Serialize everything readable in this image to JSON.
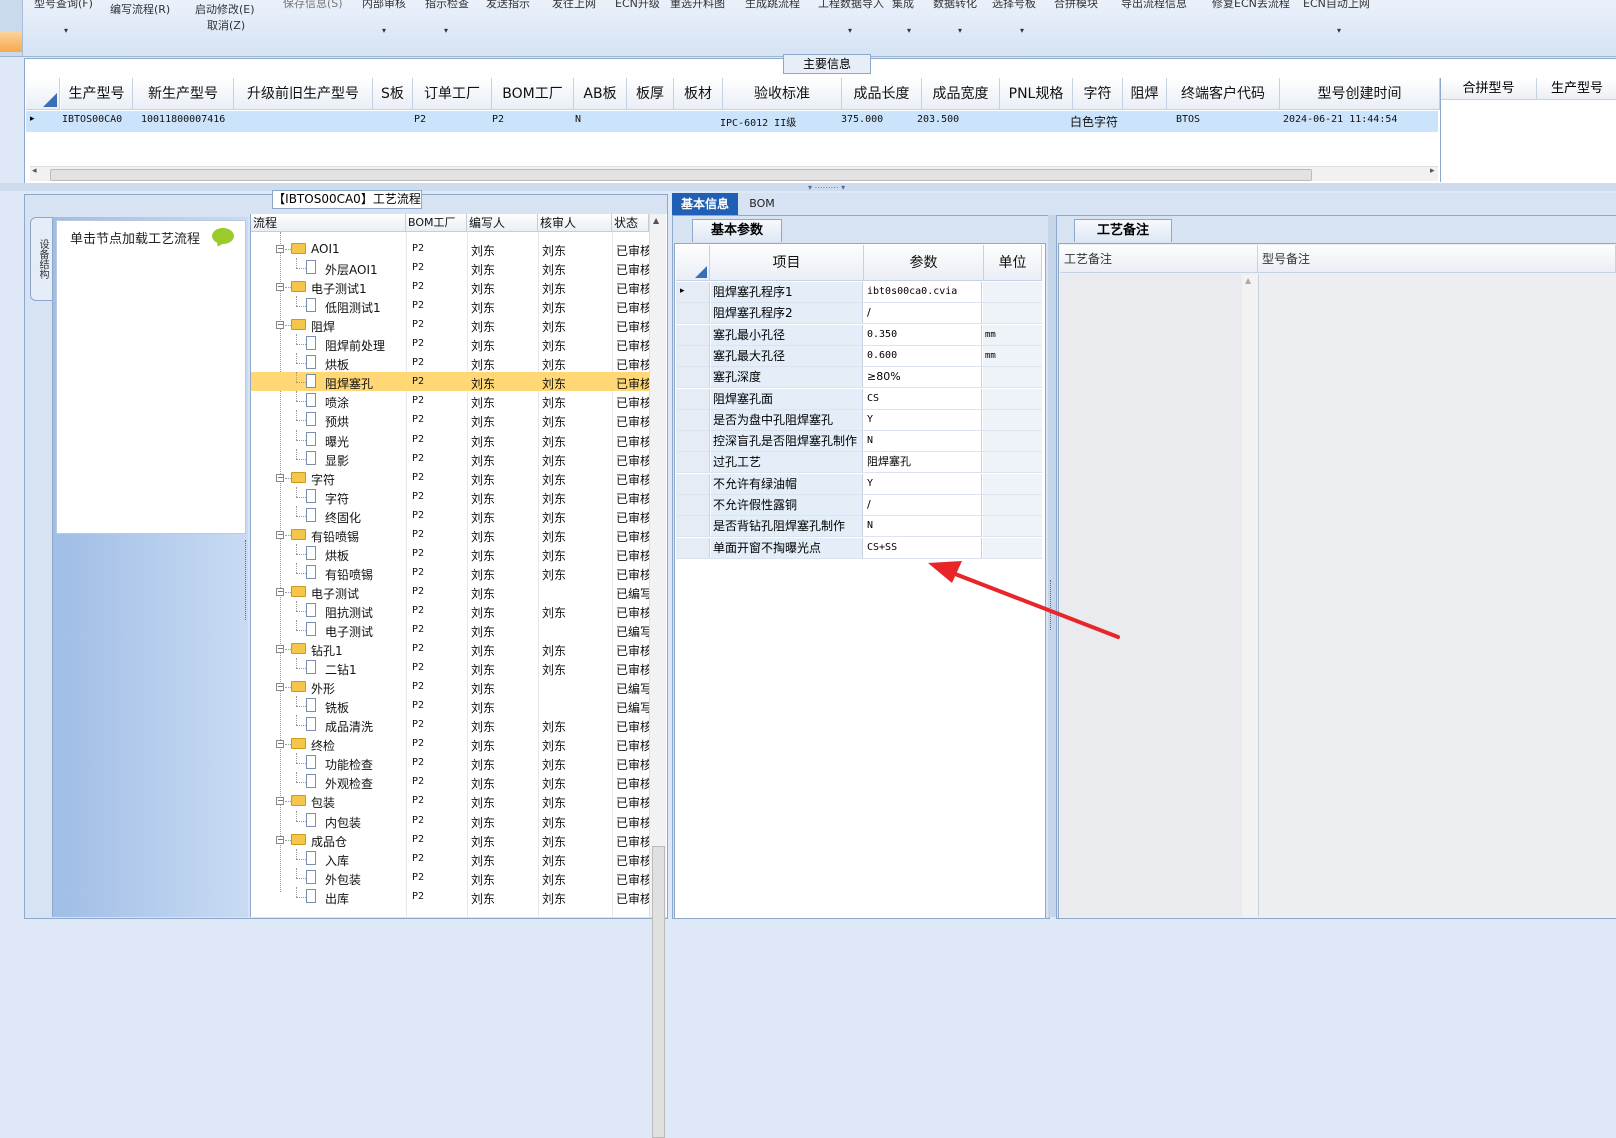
{
  "ribbon": {
    "items": [
      {
        "label": "型号查询(F)",
        "faded": false
      },
      {
        "label": "编写流程(R)",
        "faded": false
      },
      {
        "label": "启动修改(E)",
        "faded": false
      },
      {
        "label": "取消(Z)",
        "faded": false
      },
      {
        "label": "保存信息(S)",
        "faded": true
      },
      {
        "label": "内部审核",
        "faded": false
      },
      {
        "label": "指示检查",
        "faded": false
      },
      {
        "label": "发送指示",
        "faded": false
      },
      {
        "label": "发往上网",
        "faded": false
      },
      {
        "label": "ECN升级",
        "faded": false
      },
      {
        "label": "重选开料图",
        "faded": false
      },
      {
        "label": "生成跳流程",
        "faded": false
      },
      {
        "label": "工程数据导入",
        "faded": false
      },
      {
        "label": "集成",
        "faded": false
      },
      {
        "label": "数据转化",
        "faded": false
      },
      {
        "label": "选择号板",
        "faded": false
      },
      {
        "label": "合拼模块",
        "faded": false
      },
      {
        "label": "导出流程信息",
        "faded": false
      },
      {
        "label": "修复ECN丢流程",
        "faded": false
      },
      {
        "label": "ECN自动上网",
        "faded": false
      }
    ]
  },
  "main_info": {
    "title": "主要信息",
    "columns": [
      "生产型号",
      "新生产型号",
      "升级前旧生产型号",
      "S板",
      "订单工厂",
      "BOM工厂",
      "AB板",
      "板厚",
      "板材",
      "验收标准",
      "成品长度",
      "成品宽度",
      "PNL规格",
      "字符",
      "阻焊",
      "终端客户代码",
      "型号创建时间"
    ],
    "row": {
      "indicator": "▸",
      "prod_model": "IBTOS00CA0",
      "new_prod_model": "10011800007416",
      "order_factory": "P2",
      "bom_factory": "P2",
      "ab_board": "N",
      "acceptance_std": "IPC-6012 II级",
      "length": "375.000",
      "width": "203.500",
      "character": "白色字符",
      "end_customer": "BTOS",
      "created": "2024-06-21 11:44:54"
    },
    "right_columns": [
      "合拼型号",
      "生产型号"
    ]
  },
  "process": {
    "title": "【IBTOS00CA0】工艺流程",
    "side_tab": "设备结构",
    "nav_hint": "单击节点加载工艺流程",
    "columns": [
      "流程",
      "BOM工厂",
      "编写人",
      "核审人",
      "状态"
    ],
    "rows": [
      {
        "name": "AOI1",
        "level": 1,
        "bom": "P2",
        "writer": "刘东",
        "reviewer": "刘东",
        "status": "已审核",
        "selected": false
      },
      {
        "name": "外层AOI1",
        "level": 2,
        "bom": "P2",
        "writer": "刘东",
        "reviewer": "刘东",
        "status": "已审核",
        "selected": false
      },
      {
        "name": "电子测试1",
        "level": 1,
        "bom": "P2",
        "writer": "刘东",
        "reviewer": "刘东",
        "status": "已审核",
        "selected": false
      },
      {
        "name": "低阻测试1",
        "level": 2,
        "bom": "P2",
        "writer": "刘东",
        "reviewer": "刘东",
        "status": "已审核",
        "selected": false
      },
      {
        "name": "阻焊",
        "level": 1,
        "bom": "P2",
        "writer": "刘东",
        "reviewer": "刘东",
        "status": "已审核",
        "selected": false
      },
      {
        "name": "阻焊前处理",
        "level": 2,
        "bom": "P2",
        "writer": "刘东",
        "reviewer": "刘东",
        "status": "已审核",
        "selected": false
      },
      {
        "name": "烘板",
        "level": 2,
        "bom": "P2",
        "writer": "刘东",
        "reviewer": "刘东",
        "status": "已审核",
        "selected": false
      },
      {
        "name": "阻焊塞孔",
        "level": 2,
        "bom": "P2",
        "writer": "刘东",
        "reviewer": "刘东",
        "status": "已审核",
        "selected": true
      },
      {
        "name": "喷涂",
        "level": 2,
        "bom": "P2",
        "writer": "刘东",
        "reviewer": "刘东",
        "status": "已审核",
        "selected": false
      },
      {
        "name": "预烘",
        "level": 2,
        "bom": "P2",
        "writer": "刘东",
        "reviewer": "刘东",
        "status": "已审核",
        "selected": false
      },
      {
        "name": "曝光",
        "level": 2,
        "bom": "P2",
        "writer": "刘东",
        "reviewer": "刘东",
        "status": "已审核",
        "selected": false
      },
      {
        "name": "显影",
        "level": 2,
        "bom": "P2",
        "writer": "刘东",
        "reviewer": "刘东",
        "status": "已审核",
        "selected": false
      },
      {
        "name": "字符",
        "level": 1,
        "bom": "P2",
        "writer": "刘东",
        "reviewer": "刘东",
        "status": "已审核",
        "selected": false
      },
      {
        "name": "字符",
        "level": 2,
        "bom": "P2",
        "writer": "刘东",
        "reviewer": "刘东",
        "status": "已审核",
        "selected": false
      },
      {
        "name": "终固化",
        "level": 2,
        "bom": "P2",
        "writer": "刘东",
        "reviewer": "刘东",
        "status": "已审核",
        "selected": false
      },
      {
        "name": "有铅喷锡",
        "level": 1,
        "bom": "P2",
        "writer": "刘东",
        "reviewer": "刘东",
        "status": "已审核",
        "selected": false
      },
      {
        "name": "烘板",
        "level": 2,
        "bom": "P2",
        "writer": "刘东",
        "reviewer": "刘东",
        "status": "已审核",
        "selected": false
      },
      {
        "name": "有铅喷锡",
        "level": 2,
        "bom": "P2",
        "writer": "刘东",
        "reviewer": "刘东",
        "status": "已审核",
        "selected": false
      },
      {
        "name": "电子测试",
        "level": 1,
        "bom": "P2",
        "writer": "刘东",
        "reviewer": "",
        "status": "已编写",
        "selected": false
      },
      {
        "name": "阻抗测试",
        "level": 2,
        "bom": "P2",
        "writer": "刘东",
        "reviewer": "刘东",
        "status": "已审核",
        "selected": false
      },
      {
        "name": "电子测试",
        "level": 2,
        "bom": "P2",
        "writer": "刘东",
        "reviewer": "",
        "status": "已编写",
        "selected": false
      },
      {
        "name": "钻孔1",
        "level": 1,
        "bom": "P2",
        "writer": "刘东",
        "reviewer": "刘东",
        "status": "已审核",
        "selected": false
      },
      {
        "name": "二钻1",
        "level": 2,
        "bom": "P2",
        "writer": "刘东",
        "reviewer": "刘东",
        "status": "已审核",
        "selected": false
      },
      {
        "name": "外形",
        "level": 1,
        "bom": "P2",
        "writer": "刘东",
        "reviewer": "",
        "status": "已编写",
        "selected": false
      },
      {
        "name": "铣板",
        "level": 2,
        "bom": "P2",
        "writer": "刘东",
        "reviewer": "",
        "status": "已编写",
        "selected": false
      },
      {
        "name": "成品清洗",
        "level": 2,
        "bom": "P2",
        "writer": "刘东",
        "reviewer": "刘东",
        "status": "已审核",
        "selected": false
      },
      {
        "name": "终检",
        "level": 1,
        "bom": "P2",
        "writer": "刘东",
        "reviewer": "刘东",
        "status": "已审核",
        "selected": false
      },
      {
        "name": "功能检查",
        "level": 2,
        "bom": "P2",
        "writer": "刘东",
        "reviewer": "刘东",
        "status": "已审核",
        "selected": false
      },
      {
        "name": "外观检查",
        "level": 2,
        "bom": "P2",
        "writer": "刘东",
        "reviewer": "刘东",
        "status": "已审核",
        "selected": false
      },
      {
        "name": "包装",
        "level": 1,
        "bom": "P2",
        "writer": "刘东",
        "reviewer": "刘东",
        "status": "已审核",
        "selected": false
      },
      {
        "name": "内包装",
        "level": 2,
        "bom": "P2",
        "writer": "刘东",
        "reviewer": "刘东",
        "status": "已审核",
        "selected": false
      },
      {
        "name": "成品仓",
        "level": 1,
        "bom": "P2",
        "writer": "刘东",
        "reviewer": "刘东",
        "status": "已审核",
        "selected": false
      },
      {
        "name": "入库",
        "level": 2,
        "bom": "P2",
        "writer": "刘东",
        "reviewer": "刘东",
        "status": "已审核",
        "selected": false
      },
      {
        "name": "外包装",
        "level": 2,
        "bom": "P2",
        "writer": "刘东",
        "reviewer": "刘东",
        "status": "已审核",
        "selected": false
      },
      {
        "name": "出库",
        "level": 2,
        "bom": "P2",
        "writer": "刘东",
        "reviewer": "刘东",
        "status": "已审核",
        "selected": false
      }
    ]
  },
  "detail_tabs": {
    "basic": "基本信息",
    "bom": "BOM"
  },
  "params": {
    "tab": "基本参数",
    "columns": [
      "项目",
      "参数",
      "单位"
    ],
    "rows": [
      {
        "item": "阻焊塞孔程序1",
        "value": "ibt0s00ca0.cvia",
        "unit": "",
        "mono": true
      },
      {
        "item": "阻焊塞孔程序2",
        "value": "/",
        "unit": "",
        "mono": false
      },
      {
        "item": "塞孔最小孔径",
        "value": "0.350",
        "unit": "mm",
        "mono": true
      },
      {
        "item": "塞孔最大孔径",
        "value": "0.600",
        "unit": "mm",
        "mono": true
      },
      {
        "item": "塞孔深度",
        "value": "≥80%",
        "unit": "",
        "mono": false
      },
      {
        "item": "阻焊塞孔面",
        "value": "CS",
        "unit": "",
        "mono": true
      },
      {
        "item": "是否为盘中孔阻焊塞孔",
        "value": "Y",
        "unit": "",
        "mono": true
      },
      {
        "item": "控深盲孔是否阻焊塞孔制作",
        "value": "N",
        "unit": "",
        "mono": true
      },
      {
        "item": "过孔工艺",
        "value": "阻焊塞孔",
        "unit": "",
        "mono": false
      },
      {
        "item": "不允许有绿油帽",
        "value": "Y",
        "unit": "",
        "mono": true
      },
      {
        "item": "不允许假性露铜",
        "value": "/",
        "unit": "",
        "mono": false
      },
      {
        "item": "是否背钻孔阻焊塞孔制作",
        "value": "N",
        "unit": "",
        "mono": true
      },
      {
        "item": "单面开窗不掏曝光点",
        "value": "CS+SS",
        "unit": "",
        "mono": true
      }
    ]
  },
  "remarks": {
    "tab": "工艺备注",
    "columns": [
      "工艺备注",
      "型号备注"
    ]
  },
  "annotation_color": "#e8262a"
}
